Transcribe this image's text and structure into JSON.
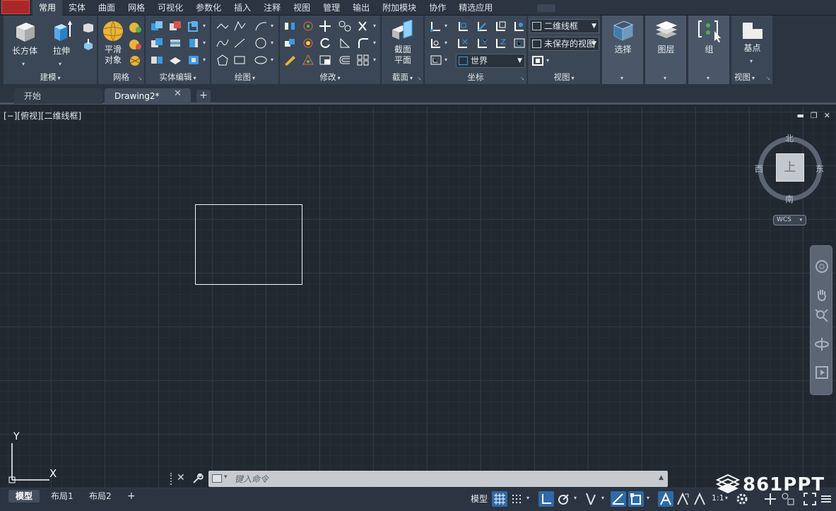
{
  "menubar": {
    "tabs": [
      "常用",
      "实体",
      "曲面",
      "网格",
      "可视化",
      "参数化",
      "插入",
      "注释",
      "视图",
      "管理",
      "输出",
      "附加模块",
      "协作",
      "精选应用"
    ],
    "active_tab": "常用"
  },
  "ribbon": {
    "modeling": {
      "label": "建模",
      "box": "长方体",
      "extrude": "拉伸"
    },
    "mesh": {
      "label": "网格",
      "smooth_1": "平滑",
      "smooth_2": "对象"
    },
    "solid_edit": {
      "label": "实体编辑"
    },
    "draw": {
      "label": "绘图"
    },
    "modify": {
      "label": "修改"
    },
    "section": {
      "label": "截面",
      "plane_1": "截面",
      "plane_2": "平面"
    },
    "coordinates": {
      "label": "坐标",
      "ucs_combo": "世界"
    },
    "view": {
      "label": "视图",
      "visual_style": "二维线框",
      "saved_view": "未保存的视图"
    },
    "selection": {
      "label": "选择"
    },
    "layers": {
      "label": "图层"
    },
    "groups": {
      "label": "组"
    },
    "view2": {
      "label": "视图",
      "base": "基点"
    }
  },
  "doctabs": {
    "start": "开始",
    "drawing": "Drawing2*",
    "close": "✕",
    "add": "+"
  },
  "viewport": {
    "label": "[−][俯视][二维线框]",
    "controls": [
      "▬",
      "❐",
      "✕"
    ],
    "viewcube": {
      "north": "北",
      "south": "南",
      "east": "东",
      "west": "西",
      "face": "上"
    },
    "wcs": "WCS",
    "ucs": {
      "x": "X",
      "y": "Y"
    }
  },
  "commandline": {
    "placeholder": "键入命令",
    "close": "✕"
  },
  "statusbar": {
    "layouts": [
      "模型",
      "布局1",
      "布局2"
    ],
    "add": "+",
    "model_label": "模型",
    "scale": "1:1"
  },
  "watermark": "861PPT",
  "colors": {
    "accent": "#2f6aa6",
    "app_button": "#a8282a",
    "background": "#212830"
  }
}
